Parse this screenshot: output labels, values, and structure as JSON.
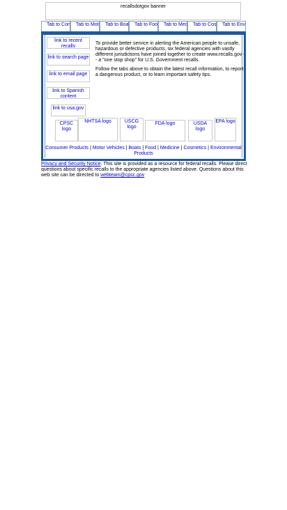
{
  "banner": {
    "alt": "recallsdotgov banner"
  },
  "tabs": [
    {
      "label": "Tab to Consumer"
    },
    {
      "label": "Tab to Motor"
    },
    {
      "label": "Tab to Boat"
    },
    {
      "label": "Tab to Food"
    },
    {
      "label": "Tab to Medicine"
    },
    {
      "label": "Tab to Cosmetic"
    },
    {
      "label": "Tab to Environme"
    }
  ],
  "sidebar": {
    "recent": "link to recent recalls",
    "search": "link to search page",
    "email": "link to email page",
    "spanish": "link to Spanish content",
    "usagov": "link to usa.gov"
  },
  "intro": {
    "p1": "To provide better service in alerting the American people to unsafe, hazardous or defective products, six federal agencies with vastly different jurisdictions have joined together to create www.recalls.gov -- a \"one stop shop\" for U.S. Government recalls.",
    "p2": "Follow the tabs above to obtain the latest recall information, to report a dangerous product, or to learn important safety tips."
  },
  "logos": {
    "cpsc": "CPSC logo",
    "nhtsa": "NHTSA logo",
    "uscg": "USCG logo",
    "fda": "FDA logo",
    "usda": "USDA logo",
    "epa": "EPA logo"
  },
  "bottom_links": {
    "consumer": "Consumer Products",
    "motor": "Motor Vehicles",
    "boats": "Boats",
    "food": "Food",
    "medicine": "Medicine",
    "cosmetics": "Cosmetics",
    "environmental": "Environmental Products",
    "separator": " | "
  },
  "footer": {
    "privacy_link": "Privacy and Security Notice",
    "text": ". This site is provided as a resource for federal recalls. Please direct questions about specific recalls to the appropriate agencies listed above. Questions about this web site can be directed to ",
    "email_link": "webteam@cpsc.gov"
  }
}
